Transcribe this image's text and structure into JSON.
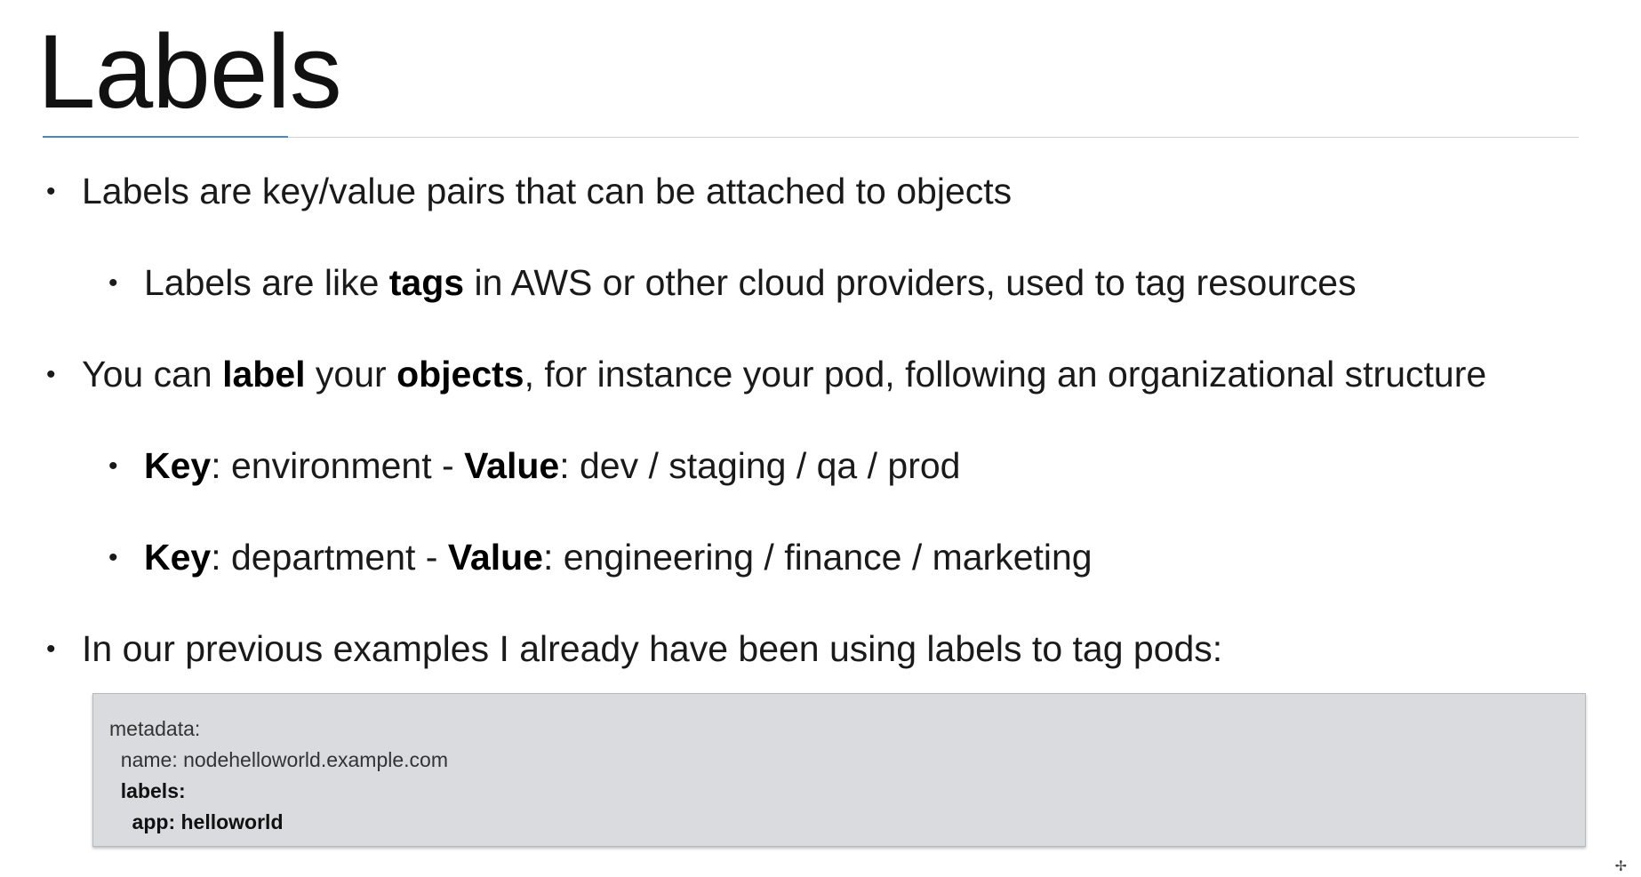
{
  "slide": {
    "title": "Labels"
  },
  "bullets": {
    "b1": "Labels are key/value pairs that can be attached to objects",
    "b2": {
      "pre": "Labels are like ",
      "bold": "tags",
      "post": " in AWS or other cloud providers, used to tag resources"
    },
    "b3": {
      "pre": "You can ",
      "bold1": "label",
      "mid": " your ",
      "bold2": "objects",
      "post": ", for instance your pod, following an organizational structure"
    },
    "b4": {
      "key": "Key",
      "key_value": ": environment - ",
      "value": "Value",
      "value_text": ": dev / staging / qa / prod"
    },
    "b5": {
      "key": "Key",
      "key_value": ": department - ",
      "value": "Value",
      "value_text": ": engineering / finance / marketing"
    },
    "b6": "In our previous examples I already have been using labels to tag pods:",
    "bullet_char": "•"
  },
  "code": {
    "line1": "metadata:",
    "line2": "  name: nodehelloworld.example.com",
    "line3": "  labels:",
    "line4": "    app: helloworld"
  }
}
